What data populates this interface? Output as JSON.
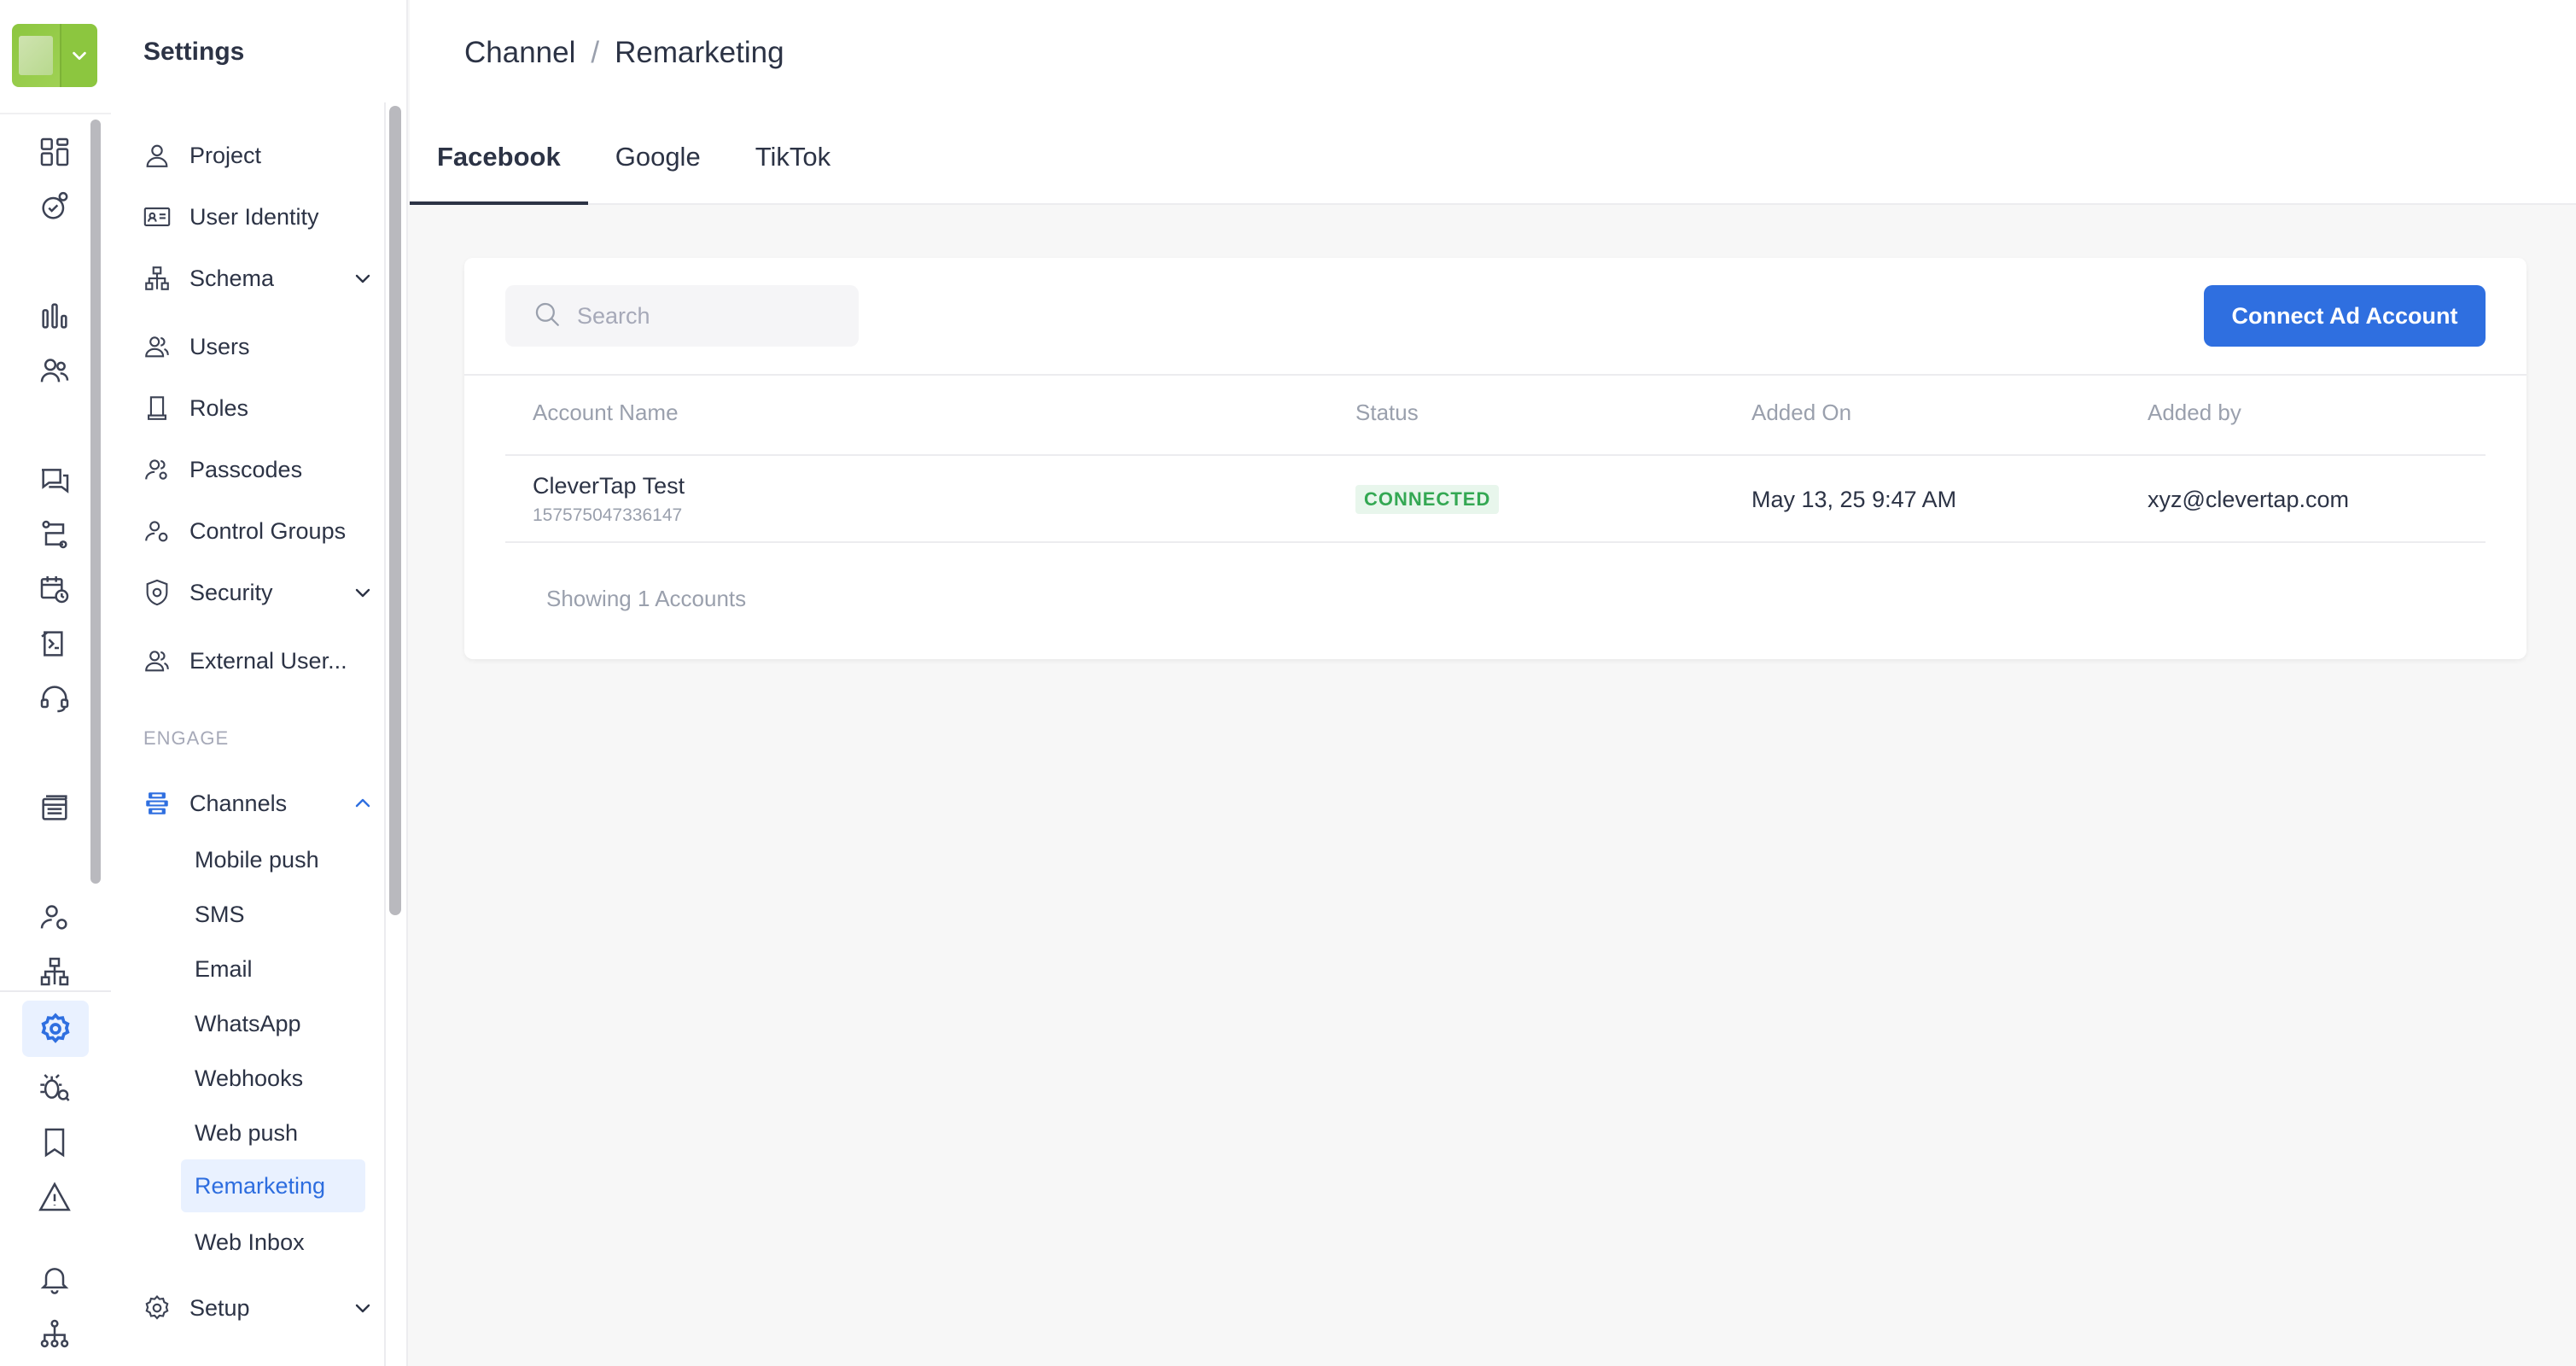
{
  "nav_title": "Settings",
  "breadcrumb": {
    "parent": "Channel",
    "separator": "/",
    "current": "Remarketing"
  },
  "tabs": [
    {
      "label": "Facebook",
      "active": true
    },
    {
      "label": "Google",
      "active": false
    },
    {
      "label": "TikTok",
      "active": false
    }
  ],
  "nav_items": {
    "project": "Project",
    "user_identity": "User Identity",
    "schema": "Schema",
    "users": "Users",
    "roles": "Roles",
    "passcodes": "Passcodes",
    "control_groups": "Control Groups",
    "security": "Security",
    "external_users": "External User...",
    "section_engage": "ENGAGE",
    "channels": "Channels",
    "setup": "Setup"
  },
  "channel_items": [
    "Mobile push",
    "SMS",
    "Email",
    "WhatsApp",
    "Webhooks",
    "Web push",
    "Remarketing",
    "Web Inbox"
  ],
  "search": {
    "placeholder": "Search",
    "value": ""
  },
  "connect_button": "Connect Ad Account",
  "table": {
    "headers": [
      "Account Name",
      "Status",
      "Added On",
      "Added by"
    ],
    "rows": [
      {
        "account_name": "CleverTap Test",
        "account_id": "157575047336147",
        "status": "CONNECTED",
        "added_on": "May 13, 25 9:47 AM",
        "added_by": "xyz@clevertap.com"
      }
    ]
  },
  "footer_text": "Showing 1 Accounts",
  "colors": {
    "accent": "#2f6fe0",
    "brand_green": "#8cc63f",
    "status_connected": "#34a853",
    "active_bg": "#e9f1ff"
  }
}
